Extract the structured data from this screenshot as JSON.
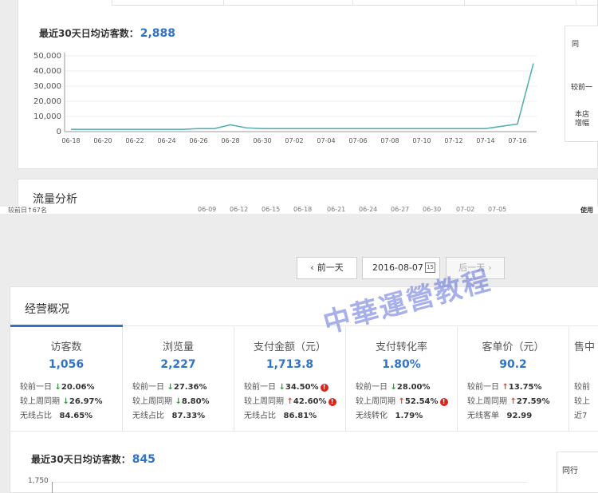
{
  "top": {
    "avg_label": "最近30天日均访客数：",
    "avg_value": "2,888",
    "chart_data": {
      "type": "line",
      "title": "",
      "xlabel": "",
      "ylabel": "",
      "ylim": [
        0,
        50000
      ],
      "y_ticks": [
        "0",
        "10,000",
        "20,000",
        "30,000",
        "40,000",
        "50,000"
      ],
      "x_tick_labels": [
        "06-18",
        "06-20",
        "06-22",
        "06-24",
        "06-26",
        "06-28",
        "06-30",
        "07-02",
        "07-04",
        "07-06",
        "07-08",
        "07-10",
        "07-12",
        "07-14",
        "07-16"
      ],
      "x": [
        "06-18",
        "06-19",
        "06-20",
        "06-21",
        "06-22",
        "06-23",
        "06-24",
        "06-25",
        "06-26",
        "06-27",
        "06-28",
        "06-29",
        "06-30",
        "07-01",
        "07-02",
        "07-03",
        "07-04",
        "07-05",
        "07-06",
        "07-07",
        "07-08",
        "07-09",
        "07-10",
        "07-11",
        "07-12",
        "07-13",
        "07-14",
        "07-15",
        "07-16",
        "07-17"
      ],
      "series": [
        {
          "values": [
            1500,
            1500,
            1500,
            1500,
            1500,
            1500,
            1500,
            1500,
            2000,
            2000,
            4500,
            2500,
            2000,
            2000,
            2000,
            2000,
            2000,
            2000,
            2000,
            2000,
            2000,
            2000,
            2000,
            2000,
            2000,
            2000,
            2000,
            3500,
            5000,
            45000
          ]
        }
      ],
      "color": "#5ab0b3",
      "grid": true
    },
    "side_labels": [
      "同",
      "较前一",
      "本店",
      "增幅"
    ],
    "flow_title": "流量分析",
    "cut_texts": [
      "较前日↑67名",
      "06-09",
      "06-12",
      "06-15",
      "06-18",
      "06-21",
      "06-24",
      "06-27",
      "06-30",
      "07-02",
      "07-05",
      "使用"
    ]
  },
  "nav": {
    "prev_label": "前一天",
    "date_value": "2016-08-07",
    "calendar_day": "15",
    "next_label": "后一天"
  },
  "overview": {
    "title": "经营概况",
    "metrics": [
      {
        "name": "访客数",
        "value": "1,056",
        "rows": [
          {
            "label": "较前一日",
            "dir": "down",
            "pct": "20.06%",
            "warn": false
          },
          {
            "label": "较上周同期",
            "dir": "down",
            "pct": "26.97%",
            "warn": false
          },
          {
            "label": "无线占比",
            "dir": "",
            "pct": "84.65%",
            "warn": false
          }
        ]
      },
      {
        "name": "浏览量",
        "value": "2,227",
        "rows": [
          {
            "label": "较前一日",
            "dir": "down",
            "pct": "27.36%",
            "warn": false
          },
          {
            "label": "较上周同期",
            "dir": "down",
            "pct": "8.80%",
            "warn": false
          },
          {
            "label": "无线占比",
            "dir": "",
            "pct": "87.33%",
            "warn": false
          }
        ]
      },
      {
        "name": "支付金额（元）",
        "value": "1,713.8",
        "rows": [
          {
            "label": "较前一日",
            "dir": "down",
            "pct": "34.50%",
            "warn": true
          },
          {
            "label": "较上周同期",
            "dir": "up",
            "pct": "42.60%",
            "warn": true
          },
          {
            "label": "无线占比",
            "dir": "",
            "pct": "86.81%",
            "warn": false
          }
        ]
      },
      {
        "name": "支付转化率",
        "value": "1.80%",
        "rows": [
          {
            "label": "较前一日",
            "dir": "down",
            "pct": "28.00%",
            "warn": false
          },
          {
            "label": "较上周同期",
            "dir": "up",
            "pct": "52.54%",
            "warn": true
          },
          {
            "label": "无线转化",
            "dir": "",
            "pct": "1.79%",
            "warn": false
          }
        ]
      },
      {
        "name": "客单价（元）",
        "value": "90.2",
        "rows": [
          {
            "label": "较前一日",
            "dir": "up",
            "pct": "13.75%",
            "warn": false
          },
          {
            "label": "较上周同期",
            "dir": "up",
            "pct": "27.59%",
            "warn": false
          },
          {
            "label": "无线客单",
            "dir": "",
            "pct": "92.99",
            "warn": false
          }
        ]
      },
      {
        "name": "售中",
        "value": "",
        "rows": [
          {
            "label": "较前",
            "dir": "",
            "pct": "",
            "warn": false
          },
          {
            "label": "较上",
            "dir": "",
            "pct": "",
            "warn": false
          },
          {
            "label": "近7",
            "dir": "",
            "pct": "",
            "warn": false
          }
        ]
      }
    ],
    "avg_label": "最近30天日均访客数：",
    "avg_value": "845",
    "y_top_tick": "1,750",
    "side_label": "同行"
  },
  "watermark": "中華運營教程",
  "colors": {
    "accent": "#2f74c8",
    "down": "#2a9d3a",
    "up": "#e24a2b",
    "line": "#5ab0b3"
  }
}
